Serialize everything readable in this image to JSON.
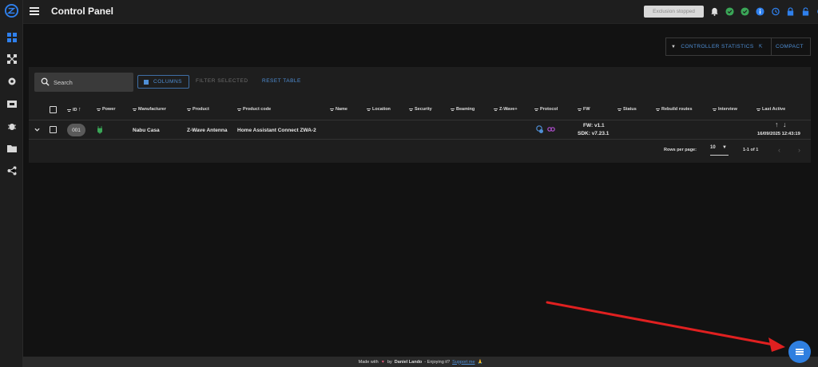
{
  "app": {
    "title": "Control Panel"
  },
  "topbar": {
    "exclusion_label": "Exclusion stopped",
    "icons": [
      "bell-icon",
      "check-circle-icon",
      "check-circle-icon",
      "info-icon",
      "clock-history-icon",
      "lock-icon",
      "lock-open-icon",
      "refresh-icon",
      "logout-icon"
    ]
  },
  "sidebar": {
    "items": [
      "dashboard-icon",
      "network-icon",
      "settings-icon",
      "scenes-icon",
      "debug-icon",
      "folder-icon",
      "share-icon"
    ]
  },
  "controller": {
    "stats_label": "CONTROLLER STATISTICS",
    "compact_label": "COMPACT"
  },
  "toolbar": {
    "search_placeholder": "Search",
    "columns_label": "COLUMNS",
    "filter_selected_label": "FILTER SELECTED",
    "reset_table_label": "RESET TABLE"
  },
  "table": {
    "headers": [
      "ID",
      "Power",
      "Manufacturer",
      "Product",
      "Product code",
      "Name",
      "Location",
      "Security",
      "Beaming",
      "Z-Wave+",
      "Protocol",
      "FW",
      "Status",
      "Rebuild routes",
      "Interview",
      "Last Active"
    ],
    "row": {
      "id": "001",
      "manufacturer": "Nabu Casa",
      "product": "Z-Wave Antenna",
      "product_code": "Home Assistant Connect ZWA-2",
      "fw": "FW: v1.1",
      "sdk": "SDK: v7.23.1",
      "last_active": "16/09/2025 12:43:19"
    },
    "footer": {
      "rows_per_page_label": "Rows per page:",
      "rows_per_page_value": "10",
      "range": "1-1 of 1"
    }
  },
  "footer": {
    "made_with": "Made with",
    "by": "by",
    "author": "Daniel Lando",
    "enjoying": "- Enjoying it?",
    "support": "Support me",
    "emoji": "🙏"
  },
  "colors": {
    "accent": "#2f7fe0",
    "background": "#121212",
    "surface": "#1e1e1e",
    "annotation_arrow": "#e02020"
  }
}
